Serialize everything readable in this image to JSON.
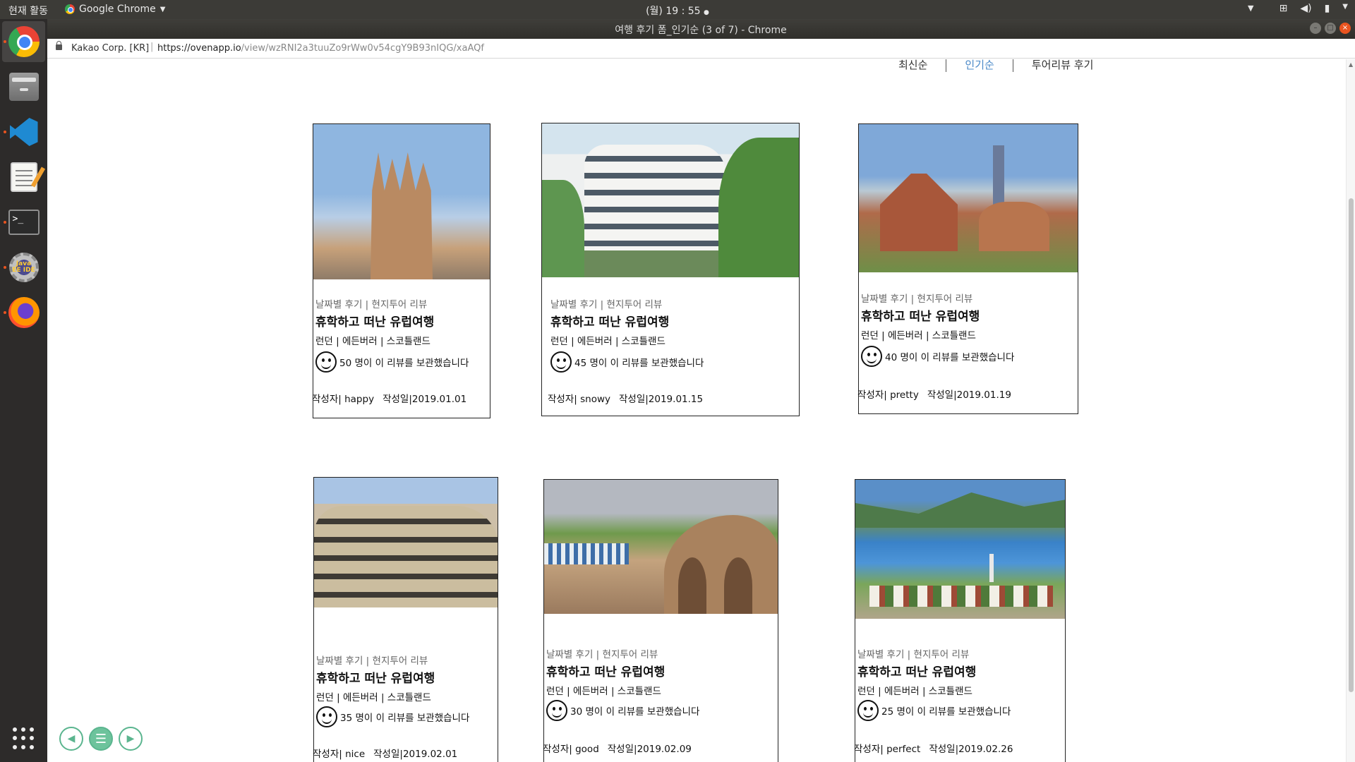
{
  "top_panel": {
    "activities": "현재 활동",
    "app_name": "Google Chrome",
    "clock": "(월) 19 : 55",
    "tray_icons": [
      "network-icon",
      "volume-icon",
      "battery-icon",
      "power-icon"
    ]
  },
  "window": {
    "title": "여행 후기 폼_인기순 (3 of 7) - Chrome"
  },
  "address_bar": {
    "org": "Kakao Corp. [KR]",
    "separator": "|",
    "url_host": "https://ovenapp.io",
    "url_path": "/view/wzRNI2a3tuuZo9rWw0v54cgY9B93nIQG/xaAQf"
  },
  "dock": {
    "apps": [
      "chrome-icon",
      "files-icon",
      "vscode-icon",
      "text-editor-icon",
      "terminal-icon",
      "eclipse-icon",
      "firefox-icon",
      "show-apps-icon"
    ],
    "eclipse_label": "Java EE IDE",
    "terminal_label": ">_"
  },
  "sort_tabs": [
    {
      "label": "최신순",
      "active": false
    },
    {
      "label": "인기순",
      "active": true
    },
    {
      "label": "투어리뷰 후기",
      "active": false
    }
  ],
  "cards": [
    {
      "kind": "날짜별 후기 | 현지투어 리뷰",
      "title": "휴학하고 떠난 유럽여행",
      "cities": "런던 | 에든버러 | 스코틀랜드",
      "saved": "50 명이 이 리뷰를 보관했습니다",
      "author": "작성자| happy",
      "date": "작성일|2019.01.01"
    },
    {
      "kind": "날짜별 후기 | 현지투어 리뷰",
      "title": "휴학하고 떠난 유럽여행",
      "cities": "런던 | 에든버러 | 스코틀랜드",
      "saved": "45 명이 이 리뷰를 보관했습니다",
      "author": "작성자| snowy",
      "date": "작성일|2019.01.15"
    },
    {
      "kind": "날짜별 후기 | 현지투어 리뷰",
      "title": "휴학하고 떠난 유럽여행",
      "cities": "런던 | 에든버러 | 스코틀랜드",
      "saved": "40 명이 이 리뷰를 보관했습니다",
      "author": "작성자| pretty",
      "date": "작성일|2019.01.19"
    },
    {
      "kind": "날짜별 후기 | 현지투어 리뷰",
      "title": "휴학하고 떠난 유럽여행",
      "cities": "런던 | 에든버러 | 스코틀랜드",
      "saved": "35 명이 이 리뷰를 보관했습니다",
      "author": "작성자| nice",
      "date": "작성일|2019.02.01"
    },
    {
      "kind": "날짜별 후기 | 현지투어 리뷰",
      "title": "휴학하고 떠난 유럽여행",
      "cities": "런던 | 에든버러 | 스코틀랜드",
      "saved": "30 명이 이 리뷰를 보관했습니다",
      "author": "작성자| good",
      "date": "작성일|2019.02.09"
    },
    {
      "kind": "날짜별 후기 | 현지투어 리뷰",
      "title": "휴학하고 떠난 유럽여행",
      "cities": "런던 | 에든버러 | 스코틀랜드",
      "saved": "25 명이 이 리뷰를 보관했습니다",
      "author": "작성자| perfect",
      "date": "작성일|2019.02.26"
    }
  ],
  "slide_controls": [
    "previous-icon",
    "menu-icon",
    "next-icon"
  ],
  "colors": {
    "accent_tab": "#4a89c8",
    "control_green": "#6dc39c",
    "ubuntu_orange": "#e95420"
  }
}
